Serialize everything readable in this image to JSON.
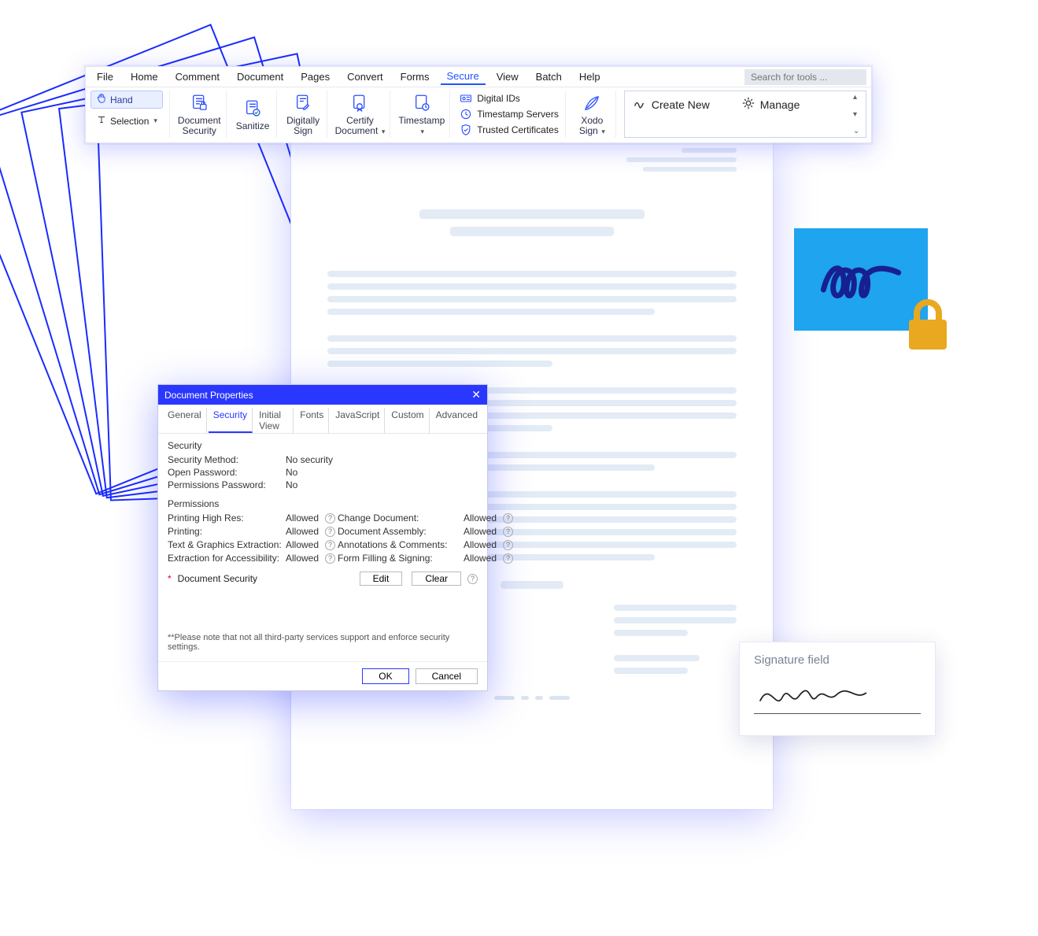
{
  "menu": {
    "items": [
      "File",
      "Home",
      "Comment",
      "Document",
      "Pages",
      "Convert",
      "Forms",
      "Secure",
      "View",
      "Batch",
      "Help"
    ],
    "active_index": 7,
    "search_placeholder": "Search for tools ..."
  },
  "leftTools": {
    "hand": "Hand",
    "selection": "Selection"
  },
  "ribbon": {
    "document_security": "Document\nSecurity",
    "sanitize": "Sanitize",
    "digitally_sign": "Digitally\nSign",
    "certify_document": "Certify\nDocument",
    "timestamp": "Timestamp",
    "digital_ids": "Digital IDs",
    "timestamp_servers": "Timestamp Servers",
    "trusted_certificates": "Trusted Certificates",
    "xodo_sign": "Xodo\nSign",
    "create_new": "Create New",
    "manage": "Manage"
  },
  "badge": {},
  "signature_card": {
    "label": "Signature field"
  },
  "dialog": {
    "title": "Document Properties",
    "tabs": [
      "General",
      "Security",
      "Initial View",
      "Fonts",
      "JavaScript",
      "Custom",
      "Advanced"
    ],
    "active_tab_index": 1,
    "security_section": {
      "heading": "Security",
      "method_label": "Security Method:",
      "method_value": "No security",
      "open_pw_label": "Open Password:",
      "open_pw_value": "No",
      "perm_pw_label": "Permissions Password:",
      "perm_pw_value": "No"
    },
    "permissions_section": {
      "heading": "Permissions",
      "rows_left": [
        {
          "label": "Printing High Res:",
          "value": "Allowed"
        },
        {
          "label": "Printing:",
          "value": "Allowed"
        },
        {
          "label": "Text & Graphics Extraction:",
          "value": "Allowed"
        },
        {
          "label": "Extraction for Accessibility:",
          "value": "Allowed"
        }
      ],
      "rows_right": [
        {
          "label": "Change Document:",
          "value": "Allowed"
        },
        {
          "label": "Document Assembly:",
          "value": "Allowed"
        },
        {
          "label": "Annotations & Comments:",
          "value": "Allowed"
        },
        {
          "label": "Form Filling & Signing:",
          "value": "Allowed"
        }
      ]
    },
    "doc_security_row": {
      "star": "*",
      "label": "Document Security",
      "edit": "Edit",
      "clear": "Clear"
    },
    "note": "**Please note that not all third-party services support and enforce security settings.",
    "footer": {
      "ok": "OK",
      "cancel": "Cancel"
    }
  }
}
